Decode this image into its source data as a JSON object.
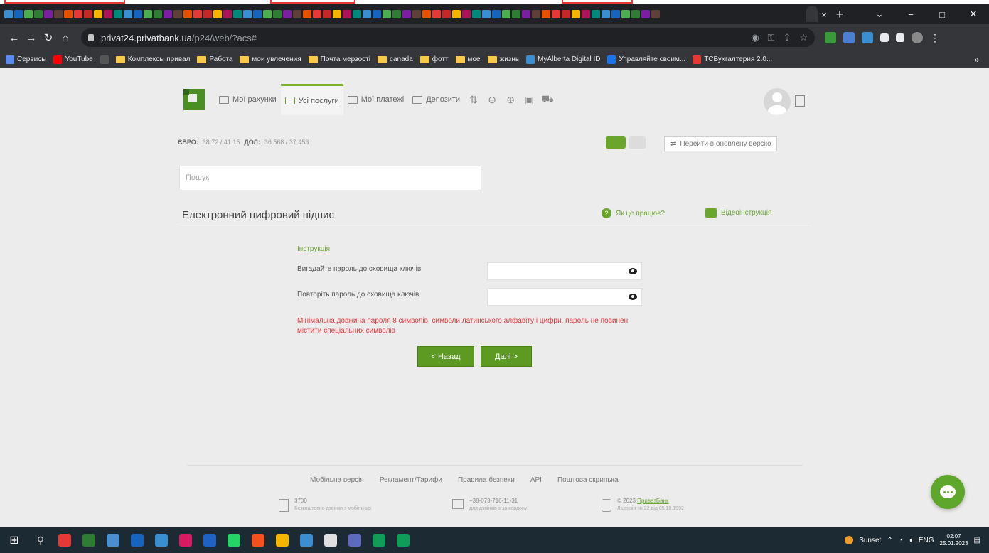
{
  "browser": {
    "url_host": "privat24.privatbank.ua",
    "url_path": "/p24/web/?acs#",
    "tab_close": "×",
    "tab_new": "+",
    "win_min": "−",
    "win_max": "□",
    "win_close": "✕"
  },
  "bookmarks": [
    {
      "label": "Сервисы",
      "kind": "apps",
      "color": "#5a8cf0"
    },
    {
      "label": "YouTube",
      "kind": "icon",
      "color": "#ff0000"
    },
    {
      "label": "",
      "kind": "icon",
      "color": "#555555"
    },
    {
      "label": "Комплексы привал",
      "kind": "folder"
    },
    {
      "label": "Работа",
      "kind": "folder"
    },
    {
      "label": "мои увлечения",
      "kind": "folder"
    },
    {
      "label": "Почта мерзості",
      "kind": "folder"
    },
    {
      "label": "canada",
      "kind": "folder"
    },
    {
      "label": "фотт",
      "kind": "folder"
    },
    {
      "label": "мое",
      "kind": "folder"
    },
    {
      "label": "жизнь",
      "kind": "folder"
    },
    {
      "label": "MyAlberta Digital ID",
      "kind": "icon",
      "color": "#3a8fd0"
    },
    {
      "label": "Управляйте своим...",
      "kind": "icon",
      "color": "#1a73e8"
    },
    {
      "label": "TCБухгалтерия 2.0...",
      "kind": "icon",
      "color": "#e53935"
    }
  ],
  "bookmarks_more": "»",
  "nav": {
    "accounts": "Мої рахунки",
    "services": "Усі послуги",
    "payments": "Мої платежі",
    "deposits": "Депозити"
  },
  "rates": {
    "eur_label": "ЄВРО:",
    "eur_value": "38.72 / 41.15",
    "usd_label": "ДОЛ:",
    "usd_value": "36.568 / 37.453"
  },
  "new_version": "Перейти в оновлену версію",
  "search": {
    "placeholder": "Пошук"
  },
  "section_title": "Електронний цифровий підпис",
  "help_link": "Як це працює?",
  "video_link": "Відеоінструкція",
  "form": {
    "instruction_link": "Інструкція",
    "password_label": "Вигадайте пароль до сховища ключів",
    "repeat_label": "Повторіть пароль до сховища ключів",
    "password_value": "",
    "repeat_value": "",
    "warning": "Мінімальна довжина пароля 8 символів, символи латинського алфавіту і цифри, пароль не повинен містити спеціальних символів",
    "back_label": "< Назад",
    "next_label": "Далі >"
  },
  "footer": {
    "links": [
      "Мобільна версія",
      "Регламент/Тарифи",
      "Правила безпеки",
      "API",
      "Поштова скринька"
    ],
    "phone_short": "3700",
    "phone_short_note": "Безкоштовно дзвінки з мобільних",
    "phone_long": "+38-073-716-11-31",
    "phone_long_note": "для дзвінків з-за кордону",
    "copyright_prefix": "© 2023",
    "bank_name": "ПриватБанк",
    "license": "Ліцензія № 22 від 05.10.1992"
  },
  "taskbar": {
    "weather": "Sunset",
    "lang": "ENG",
    "time": "02:07",
    "date": "25.01.2023"
  },
  "colors": {
    "brand_green": "#5c9a22",
    "link_green": "#6ea638",
    "warning_red": "#e23a3a"
  }
}
